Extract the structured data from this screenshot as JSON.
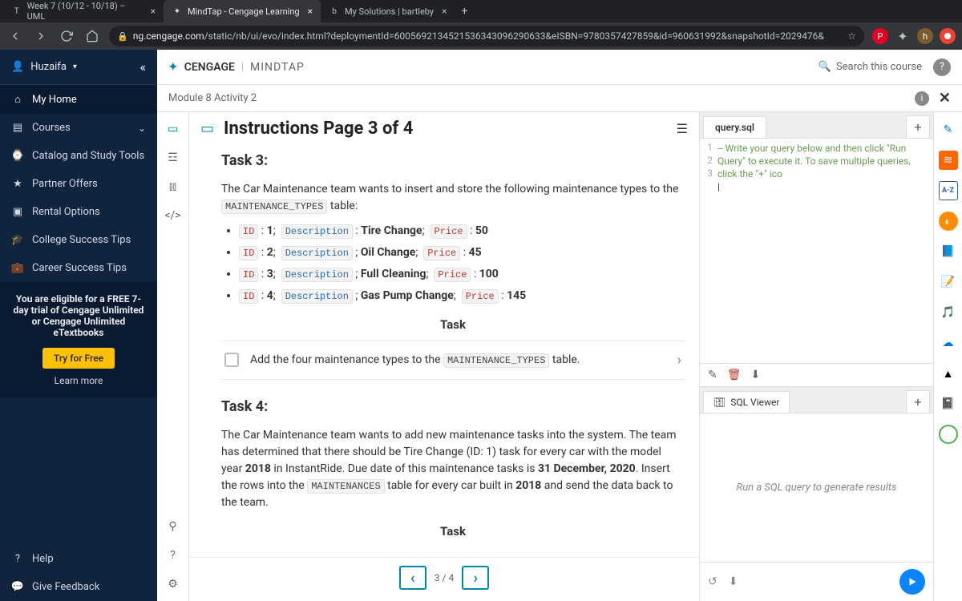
{
  "browser": {
    "tabs": [
      {
        "favicon": "T",
        "title": "Week 7 (10/12 - 10/18) – UML"
      },
      {
        "favicon": "✦",
        "title": "MindTap - Cengage Learning"
      },
      {
        "favicon": "b",
        "title": "My Solutions | bartleby"
      }
    ],
    "url_host": "ng.cengage.com",
    "url_path": "/static/nb/ui/evo/index.html?deploymentId=6005692134521536343096290633&eISBN=9780357427859&id=960631992&snapshotId=2029476&"
  },
  "sidebar": {
    "user": "Huzaifa",
    "items": [
      {
        "icon": "⌂",
        "label": "My Home"
      },
      {
        "icon": "▤",
        "label": "Courses"
      },
      {
        "icon": "⌚",
        "label": "Catalog and Study Tools"
      },
      {
        "icon": "★",
        "label": "Partner Offers"
      },
      {
        "icon": "▣",
        "label": "Rental Options"
      },
      {
        "icon": "🎓",
        "label": "College Success Tips"
      },
      {
        "icon": "💼",
        "label": "Career Success Tips"
      }
    ],
    "promo_text": "You are eligible for a FREE 7-day trial of Cengage Unlimited or Cengage Unlimited eTextbooks",
    "try_btn": "Try for Free",
    "learn_more": "Learn more",
    "help": "Help",
    "feedback": "Give Feedback"
  },
  "header": {
    "brand1": "CENGAGE",
    "brand2": "MINDTAP",
    "search_placeholder": "Search this course",
    "module_title": "Module 8 Activity 2"
  },
  "instructions": {
    "title": "Instructions Page 3 of 4",
    "task3_heading": "Task 3:",
    "task3_intro_a": "The Car Maintenance team wants to insert and store the following maintenance types to the ",
    "task3_table": "MAINTENANCE_TYPES",
    "task3_intro_b": " table:",
    "rows": [
      {
        "id": "1",
        "desc": "Tire Change",
        "price": "50",
        "sep": ":"
      },
      {
        "id": "2",
        "desc": "Oil Change",
        "price": "45",
        "sep": ";"
      },
      {
        "id": "3",
        "desc": "Full Cleaning",
        "price": "100",
        "sep": ";"
      },
      {
        "id": "4",
        "desc": "Gas Pump Change",
        "price": "145",
        "sep": ";"
      }
    ],
    "labels": {
      "id": "ID",
      "desc": "Description",
      "price": "Price"
    },
    "task_label": "Task",
    "check_text_a": "Add the four maintenance types to the ",
    "check_text_b": " table.",
    "task4_heading": "Task 4:",
    "task4_body": "The Car Maintenance team wants to add new maintenance tasks into the system. The team has determined that there should be Tire Change (ID: 1) task for every car with the model year 2018 in InstantRide. Due date of this maintenance tasks is 31 December, 2020. Insert the rows into the MAINTENANCES table for every car built in 2018 and send the data back to the team.",
    "pager": "3 / 4"
  },
  "sql": {
    "file_tab": "query.sql",
    "comment": "-- Write your query below and then click \"Run Query\" to execute it. To save multiple queries, click the \"+\" ico",
    "viewer_tab": "SQL Viewer",
    "viewer_placeholder": "Run a SQL query to generate results"
  }
}
